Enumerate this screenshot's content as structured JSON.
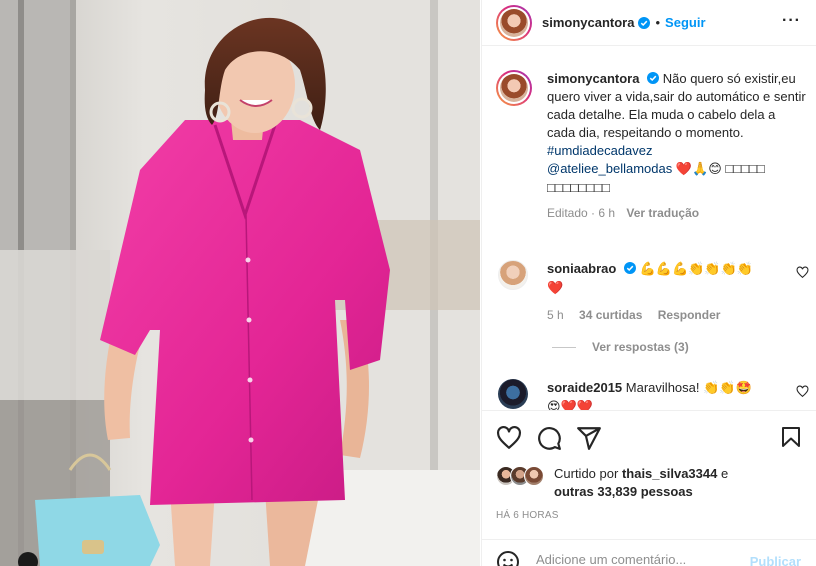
{
  "post": {
    "author": "simonycantora",
    "follow_label": "Seguir",
    "dot": "•",
    "more_label": "···"
  },
  "caption": {
    "username": "simonycantora",
    "text": "Não quero só existir,eu quero viver a vida,sair do automático e sentir cada detalhe. Ela muda o cabelo dela a cada dia, respeitando o momento.",
    "hashtag": "#umdiadecadavez",
    "mention": "@ateliee_bellamodas",
    "emojis": "❤️🙏😊",
    "trailing_boxes": "□□□□□ □□□□□□□□",
    "edited": "Editado · 6 h",
    "translate_label": "Ver tradução"
  },
  "comments": [
    {
      "username": "soniaabrao",
      "text": "💪💪💪👏👏👏👏",
      "text2": "❤️",
      "time": "5 h",
      "likes": "34 curtidas",
      "reply_label": "Responder",
      "view_replies": "Ver respostas (3)"
    },
    {
      "username": "soraide2015",
      "text": "Maravilhosa!",
      "emojis": "👏👏🤩",
      "emojis2": "😍❤️❤️"
    }
  ],
  "likes": {
    "prefix": "Curtido por",
    "user": "thais_silva3344",
    "conj": "e",
    "others": "outras 33,839 pessoas"
  },
  "time_ago": "HÁ 6 HORAS",
  "add_comment": {
    "placeholder": "Adicione um comentário...",
    "publish_label": "Publicar"
  },
  "colors": {
    "accent": "#0095f6",
    "dress_pink": "#e8299a",
    "bag_blue": "#8fd8e6"
  },
  "icons": [
    "verified-badge-icon",
    "more-options-icon",
    "heart-icon",
    "comment-icon",
    "share-icon",
    "bookmark-icon",
    "emoji-icon"
  ]
}
